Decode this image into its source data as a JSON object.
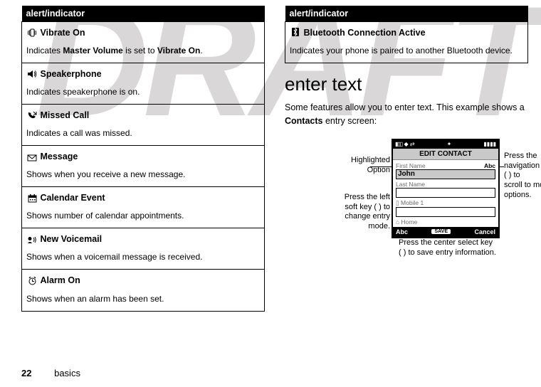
{
  "watermark": "DRAFT",
  "left": {
    "header": "alert/indicator",
    "rows": [
      {
        "icon": "vibrate",
        "title": "Vibrate On",
        "desc_pre": "Indicates ",
        "desc_b1": "Master Volume",
        "desc_mid": " is set to ",
        "desc_b2": "Vibrate On",
        "desc_post": "."
      },
      {
        "icon": "speaker",
        "title": "Speakerphone",
        "desc": "Indicates speakerphone is on."
      },
      {
        "icon": "missed",
        "title": "Missed Call",
        "desc": "Indicates a call was missed."
      },
      {
        "icon": "message",
        "title": "Message",
        "desc": "Shows when you receive a new message."
      },
      {
        "icon": "calendar",
        "title": "Calendar Event",
        "desc": "Shows number of calendar appointments.",
        "cond_title": true
      },
      {
        "icon": "voicemail",
        "title": "New Voicemail",
        "desc": "Shows when a voicemail message is received."
      },
      {
        "icon": "alarm",
        "title": "Alarm On",
        "desc": "Shows when an alarm has been set."
      }
    ]
  },
  "right": {
    "header": "alert/indicator",
    "rows": [
      {
        "icon": "bluetooth",
        "title": "Bluetooth Connection Active",
        "desc": "Indicates your phone is paired to another Bluetooth device."
      }
    ],
    "section_title": "enter text",
    "intro_pre": "Some features allow you to enter text. This example shows a ",
    "intro_b": "Contacts",
    "intro_post": " entry screen:"
  },
  "phone": {
    "title": "EDIT CONTACT",
    "f1_label": "First Name",
    "f1_mode": "Abc",
    "f1_value": "John",
    "f2_label": "Last Name",
    "f3_label": "Mobile 1",
    "f4_label": "Home",
    "soft_left": "Abc",
    "soft_mid": "SAVE",
    "soft_right": "Cancel"
  },
  "callouts": {
    "hl1": "Highlighted",
    "hl2": "Option",
    "left1": "Press the left",
    "left2": "soft key (   ) to",
    "left3": "change entry",
    "left4": "mode.",
    "right1": "Press the",
    "right2": "navigation key",
    "right3": "(   ) to",
    "right4": "scroll to more",
    "right5": "options.",
    "bottom1": "Press the center select key",
    "bottom2": "(   ) to save entry information."
  },
  "footer": {
    "page": "22",
    "section": "basics"
  }
}
